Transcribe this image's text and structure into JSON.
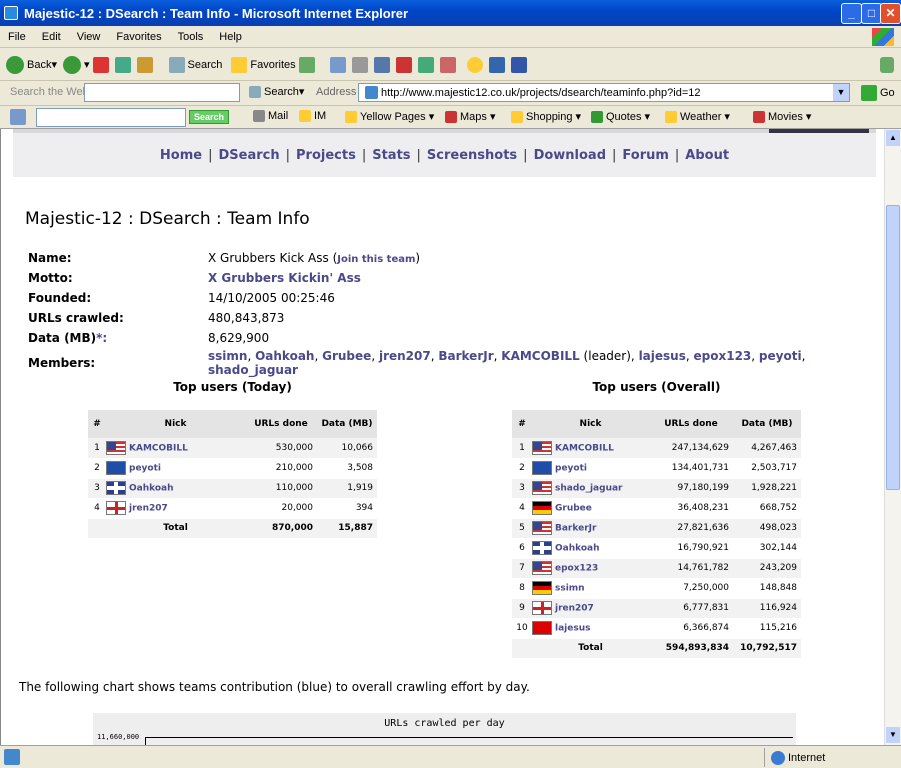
{
  "window": {
    "title": "Majestic-12 : DSearch : Team Info - Microsoft Internet Explorer"
  },
  "menu": [
    "File",
    "Edit",
    "View",
    "Favorites",
    "Tools",
    "Help"
  ],
  "toolbar": {
    "back": "Back",
    "search": "Search",
    "favorites": "Favorites"
  },
  "address": {
    "search_placeholder": "Search the Web",
    "search_label": "Search",
    "label": "Address",
    "url": "http://www.majestic12.co.uk/projects/dsearch/teaminfo.php?id=12",
    "go": "Go"
  },
  "links": {
    "search_btn": "Search",
    "mail": "Mail",
    "im": "IM",
    "yellow": "Yellow Pages",
    "maps": "Maps",
    "shopping": "Shopping",
    "quotes": "Quotes",
    "weather": "Weather",
    "movies": "Movies"
  },
  "nav": [
    "Home",
    "DSearch",
    "Projects",
    "Stats",
    "Screenshots",
    "Download",
    "Forum",
    "About"
  ],
  "page": {
    "heading": "Majestic-12 : DSearch : Team Info",
    "name_label": "Name:",
    "name": "X Grubbers Kick Ass",
    "join": "Join this team",
    "motto_label": "Motto:",
    "motto": "X Grubbers Kickin' Ass",
    "founded_label": "Founded:",
    "founded": "14/10/2005 00:25:46",
    "urls_label": "URLs crawled:",
    "urls": "480,843,873",
    "data_label": "Data (MB)",
    "data_star": "*:",
    "data": "8,629,900",
    "members_label": "Members:",
    "members": [
      "ssimn",
      "Oahkoah",
      "Grubee",
      "jren207",
      "BarkerJr",
      "KAMCOBILL",
      "lajesus",
      "epox123",
      "peyoti",
      "shado_jaguar"
    ],
    "leader_note": "(leader)",
    "chart_text": "The following chart shows teams contribution (blue) to overall crawling effort by day.",
    "chart_title": "URLs crawled per day",
    "chart_tick": "11,660,000"
  },
  "today": {
    "title": "Top users (Today)",
    "headers": [
      "#",
      "Nick",
      "URLs done",
      "Data (MB)"
    ],
    "rows": [
      {
        "n": "1",
        "flag": "us",
        "nick": "KAMCOBILL",
        "urls": "530,000",
        "data": "10,066"
      },
      {
        "n": "2",
        "flag": "qc",
        "nick": "peyoti",
        "urls": "210,000",
        "data": "3,508"
      },
      {
        "n": "3",
        "flag": "uk",
        "nick": "Oahkoah",
        "urls": "110,000",
        "data": "1,919"
      },
      {
        "n": "4",
        "flag": "en",
        "nick": "jren207",
        "urls": "20,000",
        "data": "394"
      }
    ],
    "total_label": "Total",
    "total_urls": "870,000",
    "total_data": "15,887"
  },
  "overall": {
    "title": "Top users (Overall)",
    "headers": [
      "#",
      "Nick",
      "URLs done",
      "Data (MB)"
    ],
    "rows": [
      {
        "n": "1",
        "flag": "us",
        "nick": "KAMCOBILL",
        "urls": "247,134,629",
        "data": "4,267,463"
      },
      {
        "n": "2",
        "flag": "qc",
        "nick": "peyoti",
        "urls": "134,401,731",
        "data": "2,503,717"
      },
      {
        "n": "3",
        "flag": "us",
        "nick": "shado_jaguar",
        "urls": "97,180,199",
        "data": "1,928,221"
      },
      {
        "n": "4",
        "flag": "de",
        "nick": "Grubee",
        "urls": "36,408,231",
        "data": "668,752"
      },
      {
        "n": "5",
        "flag": "us",
        "nick": "BarkerJr",
        "urls": "27,821,636",
        "data": "498,023"
      },
      {
        "n": "6",
        "flag": "uk",
        "nick": "Oahkoah",
        "urls": "16,790,921",
        "data": "302,144"
      },
      {
        "n": "7",
        "flag": "us",
        "nick": "epox123",
        "urls": "14,761,782",
        "data": "243,209"
      },
      {
        "n": "8",
        "flag": "de",
        "nick": "ssimn",
        "urls": "7,250,000",
        "data": "148,848"
      },
      {
        "n": "9",
        "flag": "en",
        "nick": "jren207",
        "urls": "6,777,831",
        "data": "116,924"
      },
      {
        "n": "10",
        "flag": "al",
        "nick": "lajesus",
        "urls": "6,366,874",
        "data": "115,216"
      }
    ],
    "total_label": "Total",
    "total_urls": "594,893,834",
    "total_data": "10,792,517"
  },
  "status": {
    "zone": "Internet"
  }
}
